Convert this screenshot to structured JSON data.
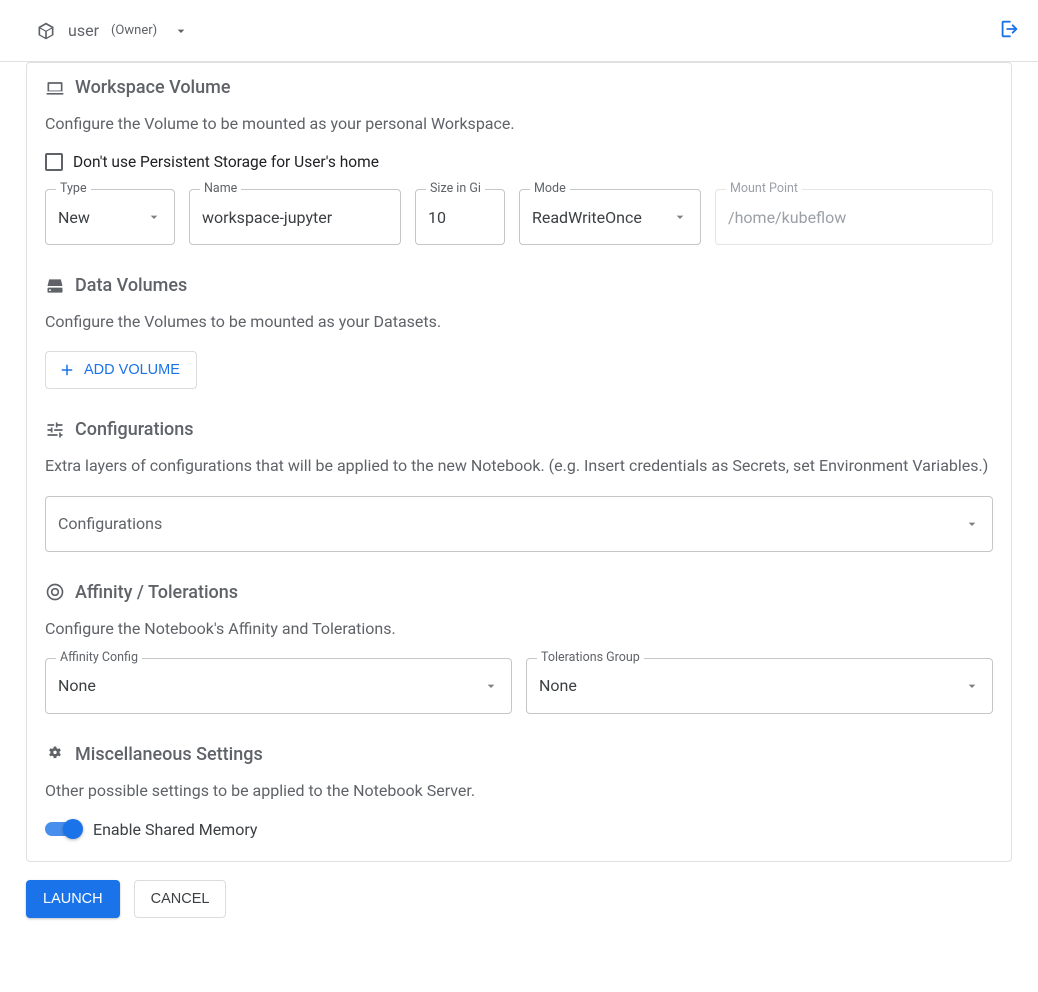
{
  "topbar": {
    "user": "user",
    "role": "(Owner)"
  },
  "workspace": {
    "title": "Workspace Volume",
    "desc": "Configure the Volume to be mounted as your personal Workspace.",
    "checkbox_label": "Don't use Persistent Storage for User's home",
    "type": {
      "label": "Type",
      "value": "New"
    },
    "name": {
      "label": "Name",
      "value": "workspace-jupyter"
    },
    "size": {
      "label": "Size in Gi",
      "value": "10"
    },
    "mode": {
      "label": "Mode",
      "value": "ReadWriteOnce"
    },
    "mount": {
      "label": "Mount Point",
      "value": "/home/kubeflow"
    }
  },
  "data_volumes": {
    "title": "Data Volumes",
    "desc": "Configure the Volumes to be mounted as your Datasets.",
    "add_btn": "ADD VOLUME"
  },
  "configurations": {
    "title": "Configurations",
    "desc": "Extra layers of configurations that will be applied to the new Notebook. (e.g. Insert credentials as Secrets, set Environment Variables.)",
    "field_label": "Configurations"
  },
  "affinity": {
    "title": "Affinity / Tolerations",
    "desc": "Configure the Notebook's Affinity and Tolerations.",
    "affinity_config": {
      "label": "Affinity Config",
      "value": "None"
    },
    "tolerations_group": {
      "label": "Tolerations Group",
      "value": "None"
    }
  },
  "misc": {
    "title": "Miscellaneous Settings",
    "desc": "Other possible settings to be applied to the Notebook Server.",
    "toggle_label": "Enable Shared Memory",
    "toggle_checked": true
  },
  "footer": {
    "launch": "LAUNCH",
    "cancel": "CANCEL"
  }
}
